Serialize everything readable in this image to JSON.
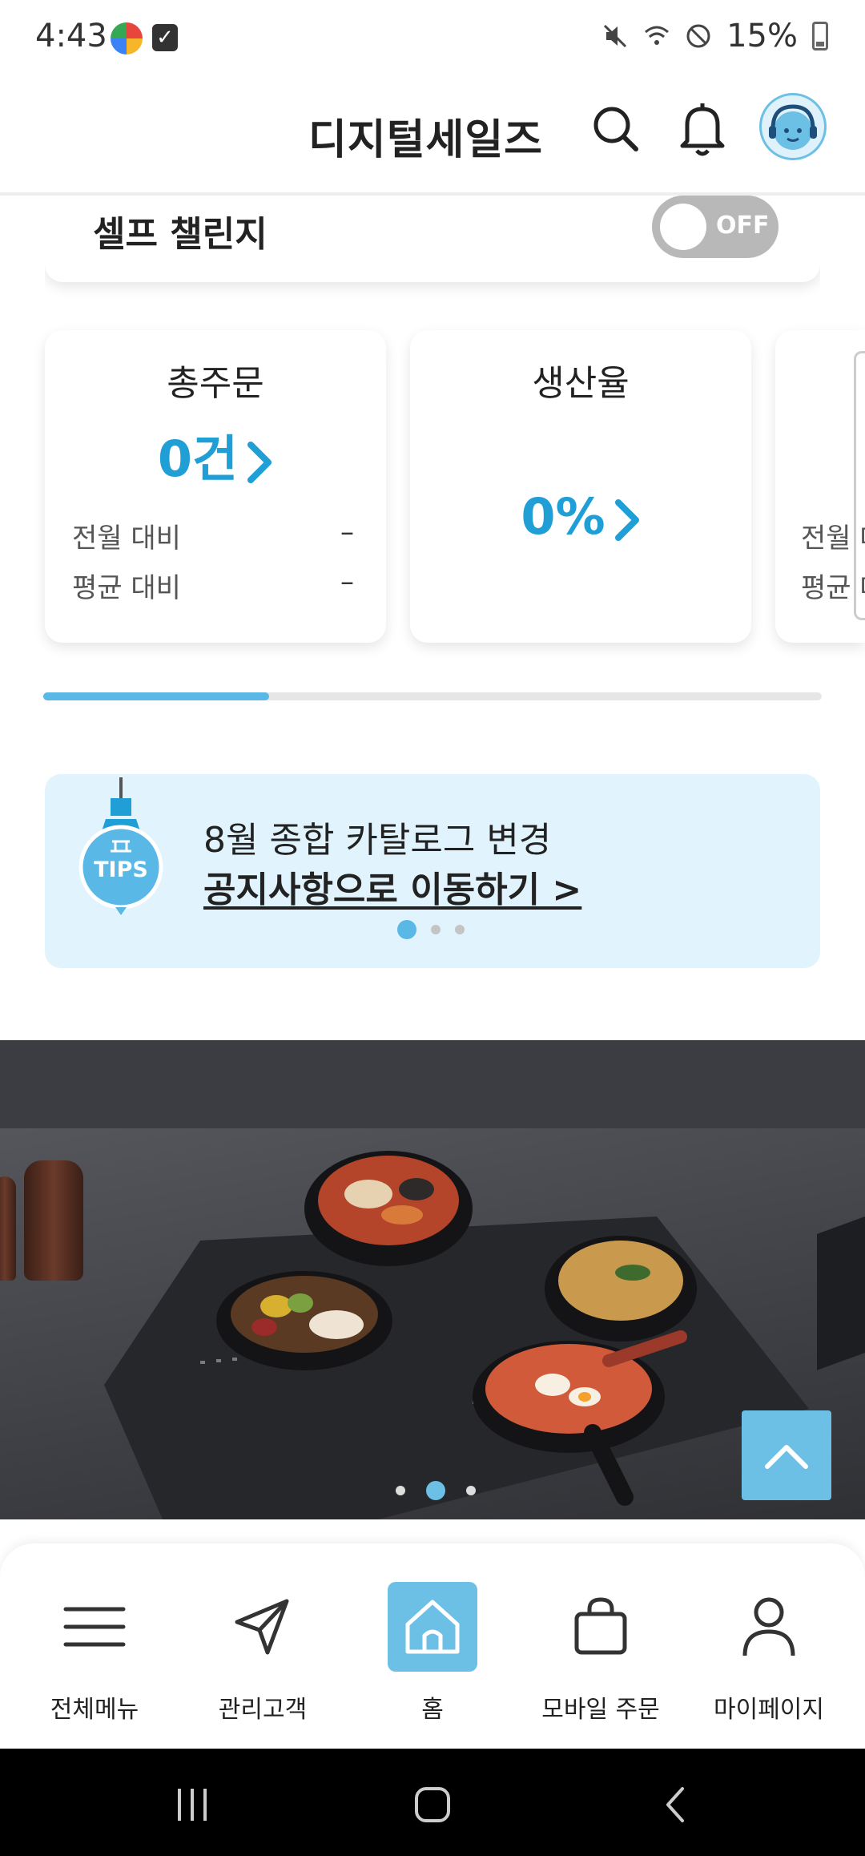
{
  "status_bar": {
    "time": "4:43",
    "battery_text": "15%",
    "icons": [
      "multi-app-icon",
      "checkbox-app-icon",
      "mute-icon",
      "wifi-icon",
      "dnd-icon",
      "battery-icon"
    ]
  },
  "header": {
    "brand": "디지털세일즈",
    "icons": [
      "search-icon",
      "bell-icon",
      "avatar-headset-icon"
    ]
  },
  "challenge": {
    "title": "셀프 챌린지",
    "toggle_label": "OFF",
    "toggle_on": false
  },
  "stats": {
    "total_orders": {
      "title": "총주문",
      "value": "0건",
      "rows": [
        {
          "label": "전월 대비",
          "value": "–"
        },
        {
          "label": "평균 대비",
          "value": "–"
        }
      ]
    },
    "production_rate": {
      "title": "생산율",
      "value": "0%"
    },
    "third_card": {
      "rows": [
        {
          "label": "전월 대"
        },
        {
          "label": "평균 대"
        }
      ]
    },
    "scroll_progress": 0.29
  },
  "tips": {
    "badge": "TIPS",
    "line1": "8월 종합 카탈로그 변경",
    "line2": "공지사항으로 이동하기 >",
    "page_count": 3,
    "active_page": 1
  },
  "hero": {
    "page_count": 3,
    "active_page": 2
  },
  "colors": {
    "accent": "#1f9fd6",
    "light_accent": "#6cc0e5",
    "tips_bg": "#e1f4fd"
  },
  "bottom_nav": {
    "items": [
      {
        "label": "전체메뉴",
        "icon": "menu-icon"
      },
      {
        "label": "관리고객",
        "icon": "paper-plane-icon"
      },
      {
        "label": "홈",
        "icon": "home-icon",
        "active": true
      },
      {
        "label": "모바일 주문",
        "icon": "shopping-bag-icon"
      },
      {
        "label": "마이페이지",
        "icon": "person-icon"
      }
    ]
  }
}
